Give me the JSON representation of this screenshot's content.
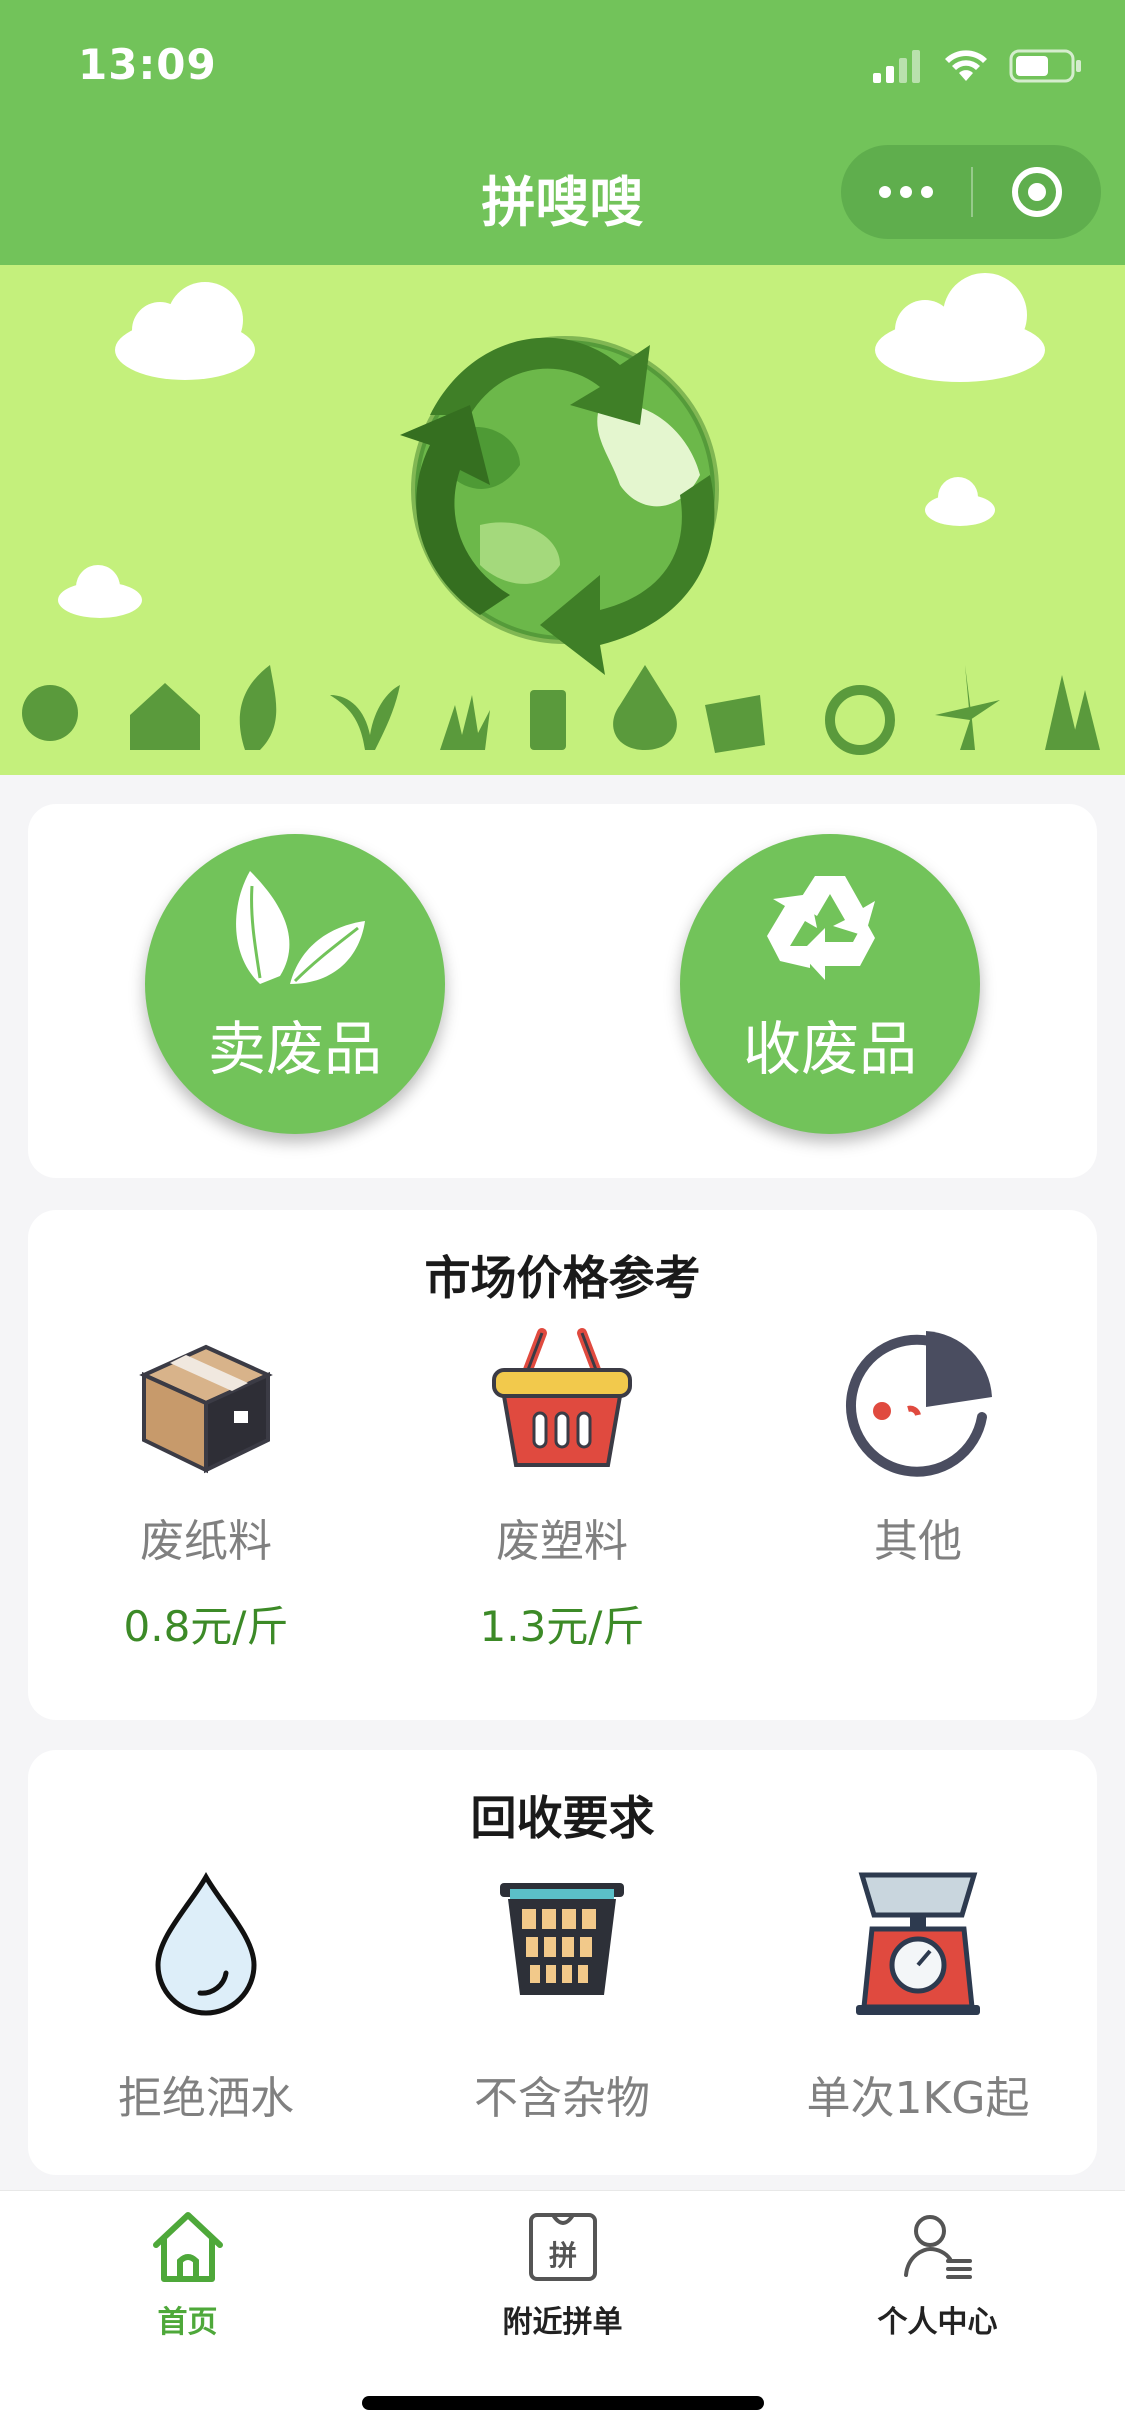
{
  "status_bar": {
    "time": "13:09",
    "signal_icon": "signal-icon",
    "wifi_icon": "wifi-icon",
    "battery_icon": "battery-icon"
  },
  "nav": {
    "title": "拼嗖嗖",
    "more_icon": "more-dots-icon",
    "close_icon": "target-close-icon"
  },
  "banner": {
    "image": "recycling-globe-illustration",
    "background_color": "#c4f07c"
  },
  "actions": [
    {
      "label": "卖废品",
      "icon": "leaf-icon"
    },
    {
      "label": "收废品",
      "icon": "recycle-icon"
    }
  ],
  "prices": {
    "title": "市场价格参考",
    "items": [
      {
        "name": "废纸料",
        "price": "0.8元/斤",
        "icon": "cardboard-box-icon"
      },
      {
        "name": "废塑料",
        "price": "1.3元/斤",
        "icon": "basket-icon"
      },
      {
        "name": "其他",
        "price": "",
        "icon": "pie-clock-icon"
      }
    ]
  },
  "requirements": {
    "title": "回收要求",
    "items": [
      {
        "name": "拒绝洒水",
        "icon": "water-drop-icon"
      },
      {
        "name": "不含杂物",
        "icon": "trash-bin-icon"
      },
      {
        "name": "单次1KG起",
        "icon": "weighing-scale-icon"
      }
    ]
  },
  "tabbar": {
    "items": [
      {
        "label": "首页",
        "icon": "home-icon",
        "active": true
      },
      {
        "label": "附近拼单",
        "icon": "group-order-icon",
        "active": false
      },
      {
        "label": "个人中心",
        "icon": "user-icon",
        "active": false
      }
    ]
  },
  "colors": {
    "primary": "#72c35a",
    "price_text": "#3c8a27",
    "active_tab": "#4ea83a"
  }
}
